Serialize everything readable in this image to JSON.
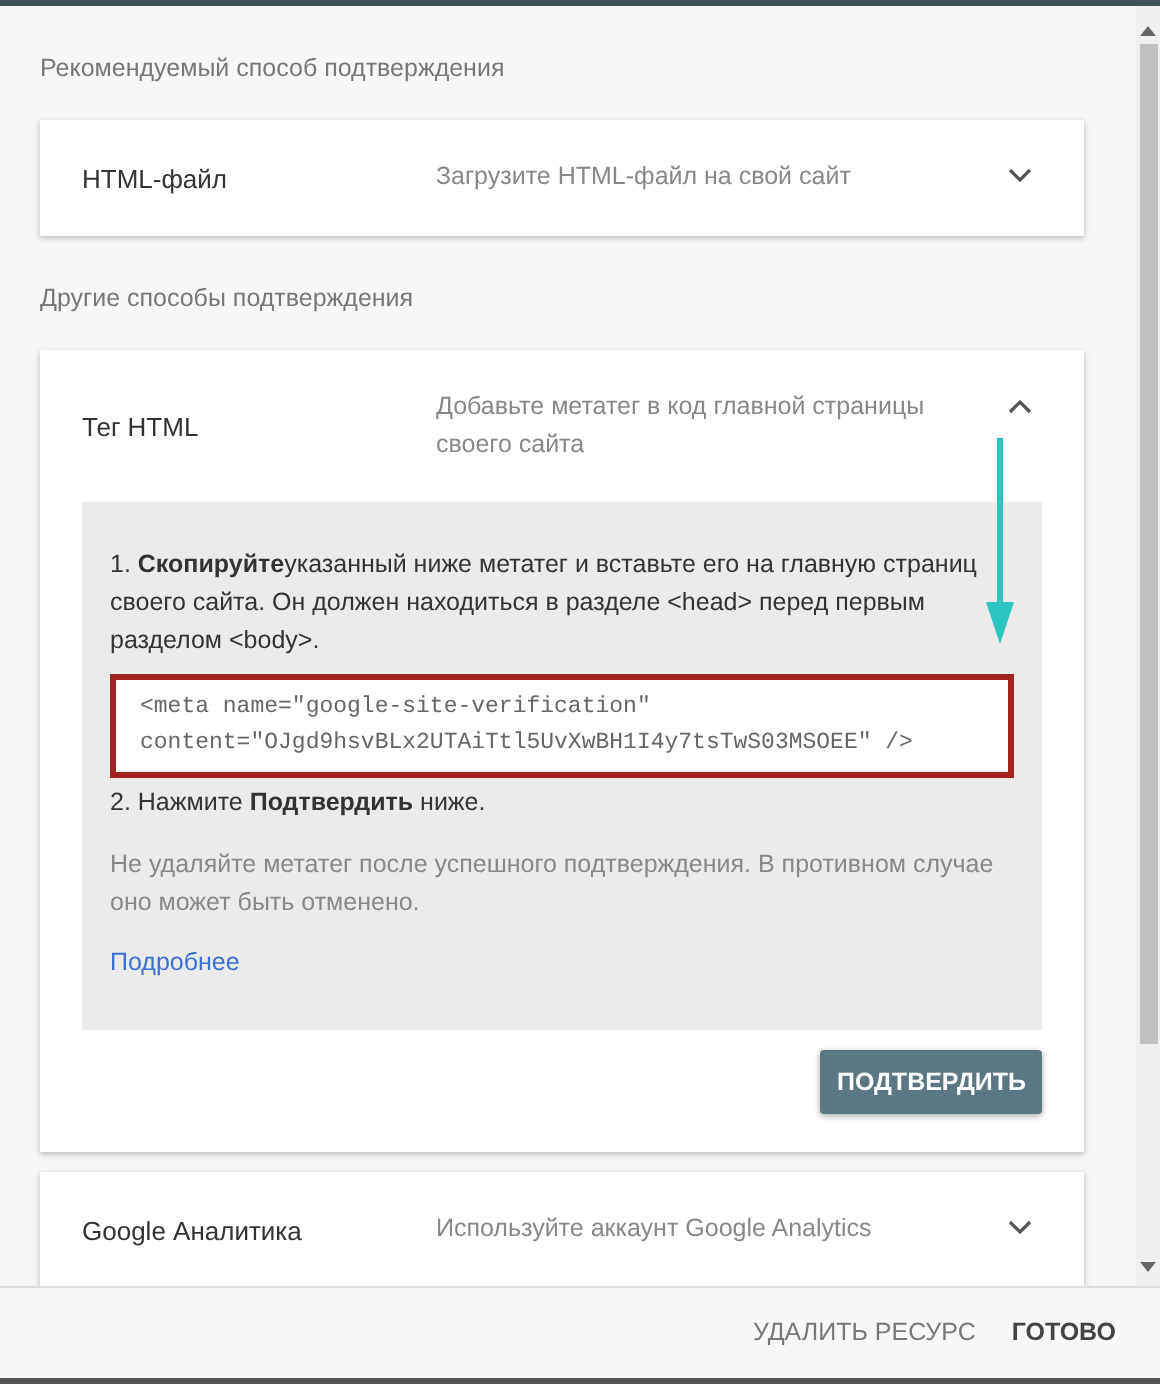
{
  "sections": [
    {
      "heading": "Рекомендуемый способ подтверждения",
      "methods": [
        {
          "title": "HTML-файл",
          "description": "Загрузите HTML-файл на свой сайт",
          "expanded": false
        }
      ]
    },
    {
      "heading": "Другие способы подтверждения",
      "methods": [
        {
          "title": "Тег HTML",
          "description": "Добавьте метатег в код главной страницы своего сайта",
          "expanded": true,
          "details": {
            "step_1": "1. **Скопируйте**указанный ниже метатег и вставьте его на главную страниц своего сайта. Он должен находиться в разделе <head> перед первым разделом <body>.",
            "code": "<meta name=\"google-site-verification\" content=\"OJgd9hsvBLx2UTAiTtl5UvXwBH1I4y7tsTwS03MSOEE\" />",
            "step_2": "2. Нажмите **Подтвердить** ниже.",
            "note": "Не удаляйте метатег после успешного подтверждения. В противном случае оно может быть отменено.",
            "link": "Подробнее",
            "button": "ПОДТВЕРДИТЬ"
          }
        },
        {
          "title": "Google Аналитика",
          "description": "Используйте аккаунт Google Analytics",
          "expanded": false
        }
      ]
    }
  ],
  "footer": {
    "buttons": [
      "УДАЛИТЬ РЕСУРС",
      "ГОТОВО"
    ]
  }
}
